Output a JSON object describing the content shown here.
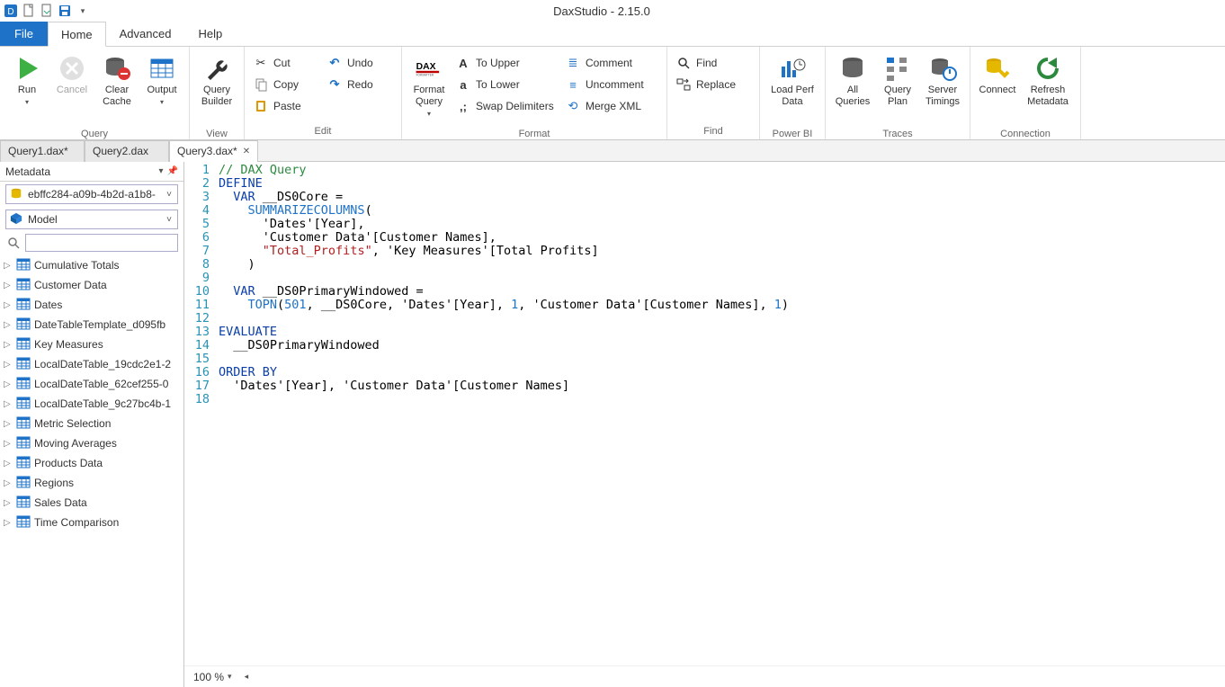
{
  "app": {
    "title": "DaxStudio - 2.15.0"
  },
  "tabs": {
    "file": "File",
    "items": [
      "Home",
      "Advanced",
      "Help"
    ],
    "active": 0
  },
  "ribbon": {
    "query_group": "Query",
    "run": "Run",
    "cancel": "Cancel",
    "clear_cache": "Clear\nCache",
    "output": "Output",
    "view_group": "View",
    "query_builder": "Query\nBuilder",
    "edit_group": "Edit",
    "cut": "Cut",
    "copy": "Copy",
    "paste": "Paste",
    "undo": "Undo",
    "redo": "Redo",
    "format_query": "Format\nQuery",
    "format_group": "Format",
    "to_upper": "To Upper",
    "to_lower": "To Lower",
    "swap_delim": "Swap Delimiters",
    "comment": "Comment",
    "uncomment": "Uncomment",
    "merge_xml": "Merge XML",
    "find_group": "Find",
    "find": "Find",
    "replace": "Replace",
    "powerbi_group": "Power BI",
    "load_perf": "Load Perf\nData",
    "traces_group": "Traces",
    "all_queries": "All\nQueries",
    "query_plan": "Query\nPlan",
    "server_timings": "Server\nTimings",
    "connection_group": "Connection",
    "connect": "Connect",
    "refresh_meta": "Refresh\nMetadata"
  },
  "doc_tabs": [
    {
      "label": "Query1.dax*",
      "active": false,
      "close": false
    },
    {
      "label": "Query2.dax",
      "active": false,
      "close": false
    },
    {
      "label": "Query3.dax*",
      "active": true,
      "close": true
    }
  ],
  "sidebar": {
    "title": "Metadata",
    "db": "ebffc284-a09b-4b2d-a1b8-",
    "model": "Model",
    "search": "",
    "items": [
      "Cumulative Totals",
      "Customer Data",
      "Dates",
      "DateTableTemplate_d095fb",
      "Key Measures",
      "LocalDateTable_19cdc2e1-2",
      "LocalDateTable_62cef255-0",
      "LocalDateTable_9c27bc4b-1",
      "Metric Selection",
      "Moving Averages",
      "Products Data",
      "Regions",
      "Sales Data",
      "Time Comparison"
    ]
  },
  "editor": {
    "lines": [
      {
        "n": 1,
        "html": "<span class='c-comment'>// DAX Query</span>"
      },
      {
        "n": 2,
        "html": "<span class='c-kw'>DEFINE</span>"
      },
      {
        "n": 3,
        "html": "  <span class='c-kw'>VAR</span> __DS0Core ="
      },
      {
        "n": 4,
        "html": "    <span class='c-fn'>SUMMARIZECOLUMNS</span>("
      },
      {
        "n": 5,
        "html": "      'Dates'[Year],"
      },
      {
        "n": 6,
        "html": "      'Customer Data'[Customer Names],"
      },
      {
        "n": 7,
        "html": "      <span class='c-str'>\"Total_Profits\"</span>, 'Key Measures'[Total Profits]"
      },
      {
        "n": 8,
        "html": "    )"
      },
      {
        "n": 9,
        "html": ""
      },
      {
        "n": 10,
        "html": "  <span class='c-kw'>VAR</span> __DS0PrimaryWindowed ="
      },
      {
        "n": 11,
        "html": "    <span class='c-fn'>TOPN</span>(<span class='c-num'>501</span>, __DS0Core, 'Dates'[Year], <span class='c-num'>1</span>, 'Customer Data'[Customer Names], <span class='c-num'>1</span>)"
      },
      {
        "n": 12,
        "html": ""
      },
      {
        "n": 13,
        "html": "<span class='c-kw'>EVALUATE</span>"
      },
      {
        "n": 14,
        "html": "  __DS0PrimaryWindowed"
      },
      {
        "n": 15,
        "html": ""
      },
      {
        "n": 16,
        "html": "<span class='c-kw'>ORDER BY</span>"
      },
      {
        "n": 17,
        "html": "  'Dates'[Year], 'Customer Data'[Customer Names]"
      },
      {
        "n": 18,
        "html": ""
      }
    ],
    "zoom": "100 %"
  }
}
